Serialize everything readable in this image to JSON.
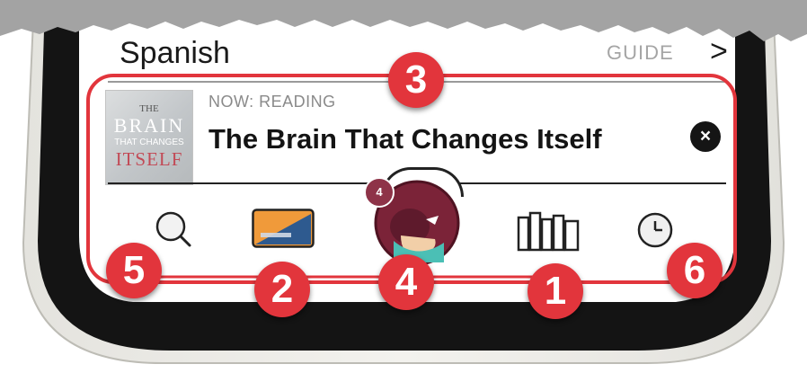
{
  "header": {
    "language": "Spanish",
    "guide_label": "GUIDE",
    "chevron": ">"
  },
  "now_reading": {
    "label": "NOW: READING",
    "title": "The Brain That Changes Itself",
    "cover": {
      "line1": "THE",
      "line2": "BRAIN",
      "line3": "THAT CHANGES",
      "line4": "ITSELF"
    },
    "close_icon": "close-icon"
  },
  "tab_bar": {
    "items": [
      {
        "icon": "search-icon"
      },
      {
        "icon": "card-icon"
      },
      {
        "icon": "avatar-icon"
      },
      {
        "icon": "library-icon"
      },
      {
        "icon": "clock-icon"
      }
    ],
    "badge_count": "4"
  },
  "callouts": [
    "3",
    "5",
    "2",
    "4",
    "1",
    "6"
  ],
  "colors": {
    "callout_red": "#e2353c",
    "avatar_maroon": "#7b2338",
    "card_orange": "#f09a3a",
    "card_blue": "#2e5a8f"
  }
}
